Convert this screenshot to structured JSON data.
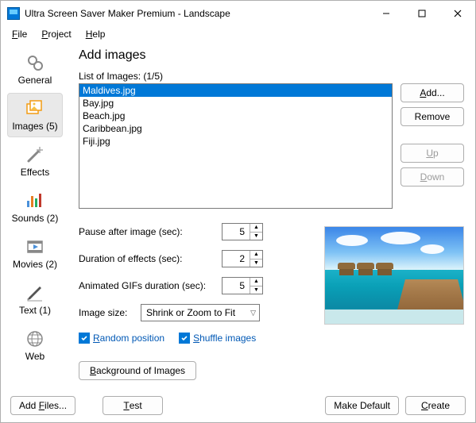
{
  "titlebar": {
    "title": "Ultra Screen Saver Maker Premium - Landscape"
  },
  "menu": {
    "file": "File",
    "project": "Project",
    "help": "Help"
  },
  "sidebar": {
    "general": "General",
    "images": "Images (5)",
    "effects": "Effects",
    "sounds": "Sounds (2)",
    "movies": "Movies (2)",
    "text": "Text (1)",
    "web": "Web"
  },
  "content": {
    "heading": "Add images",
    "list_header": "List of Images:  (1/5)",
    "images": [
      "Maldives.jpg",
      "Bay.jpg",
      "Beach.jpg",
      "Caribbean.jpg",
      "Fiji.jpg"
    ],
    "selected_index": 0,
    "btns": {
      "add": "Add...",
      "remove": "Remove",
      "up": "Up",
      "down": "Down"
    },
    "pause_label": "Pause after image (sec):",
    "pause_value": "5",
    "duration_label": "Duration of effects (sec):",
    "duration_value": "2",
    "gif_label": "Animated GIFs duration (sec):",
    "gif_value": "5",
    "size_label": "Image size:",
    "size_value": "Shrink or Zoom to Fit",
    "random_label": "Random position",
    "shuffle_label": "Shuffle images",
    "bg_button": "Background of Images"
  },
  "bottom": {
    "add_files": "Add Files...",
    "test": "Test",
    "make_default": "Make Default",
    "create": "Create"
  }
}
